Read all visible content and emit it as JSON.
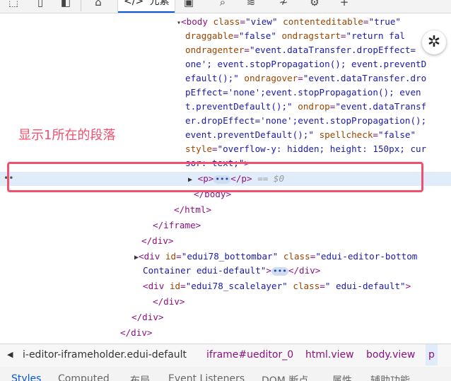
{
  "toolbar": {
    "icons": [
      "inspect-icon",
      "device-icon",
      "panel-icon",
      "home-icon",
      "elements-icon",
      "console-icon",
      "sources-icon",
      "network-icon",
      "performance-icon",
      "settings-icon",
      "add-icon"
    ],
    "elements_tab_glyph": "</>",
    "elements_tab_label": "元素"
  },
  "dom": {
    "body_open": {
      "tag_open": "<body",
      "attrs": [
        {
          "name": "class",
          "value": "\"view\""
        },
        {
          "name": "contenteditable",
          "value": "\"true\""
        },
        {
          "name": "draggable",
          "value": "\"false\""
        },
        {
          "name": "ondragstart",
          "value": "\"return fal"
        }
      ],
      "line3_attr": "ondragenter",
      "line3_val": "\"event.dataTransfer.dropEffect=",
      "line4": "one'; event.stopPropagation(); event.preventD",
      "line5_a": "efault();\"",
      "line5_attr": "ondragover",
      "line5_val": "\"event.dataTransfer.dro",
      "line6": "pEffect='none';event.stopPropagation(); even",
      "line7_a": "t.preventDefault();\"",
      "line7_attr": "ondrop",
      "line7_val": "\"event.dataTransf",
      "line8": "er.dropEffect='none';event.stopPropagation();",
      "line9_a": "event.preventDefault();\"",
      "line9_attr": "spellcheck",
      "line9_val": "\"false\"",
      "line10_attr": "style",
      "line10_val": "\"overflow-y: hidden; height: 150px; cur",
      "line11_val": "sor: text;\"",
      "line11_close": ">"
    },
    "p_line": {
      "open": "<p>",
      "dots": "•••",
      "close": "</p>",
      "marker": "== $0"
    },
    "close_body": "</body>",
    "close_html": "</html>",
    "close_iframe": "</iframe>",
    "close_div_1": "</div>",
    "bottombar": {
      "tag": "<div",
      "id_attr": "id",
      "id_val": "\"edui78_bottombar\"",
      "class_attr": "class",
      "class_val": "\"edui-editor-bottom",
      "class_val_2": "Container edui-default\"",
      "close": "</div>"
    },
    "scalelayer": {
      "tag": "<div",
      "id_attr": "id",
      "id_val": "\"edui78_scalelayer\"",
      "class_attr": "class",
      "class_val": "\" edui-default\"",
      "close": ">"
    },
    "close_div_2": "</div>",
    "close_div_3": "</div>",
    "close_div_4": "</div>"
  },
  "annotation": {
    "text": "显示1所在的段落",
    "color": "#f0506e"
  },
  "breadcrumbs": [
    {
      "label": "i-editor-iframeholder.edui-default",
      "kind": "text"
    },
    {
      "label": "iframe#ueditor_0",
      "kind": "elem"
    },
    {
      "label": "html.view",
      "kind": "elem"
    },
    {
      "label": "body.view",
      "kind": "elem"
    },
    {
      "label": "p",
      "kind": "selected"
    }
  ],
  "bottom_tabs": [
    "Styles",
    "Computed",
    "布局",
    "Event Listeners",
    "DOM 断点",
    "属性",
    "辅助功能"
  ]
}
